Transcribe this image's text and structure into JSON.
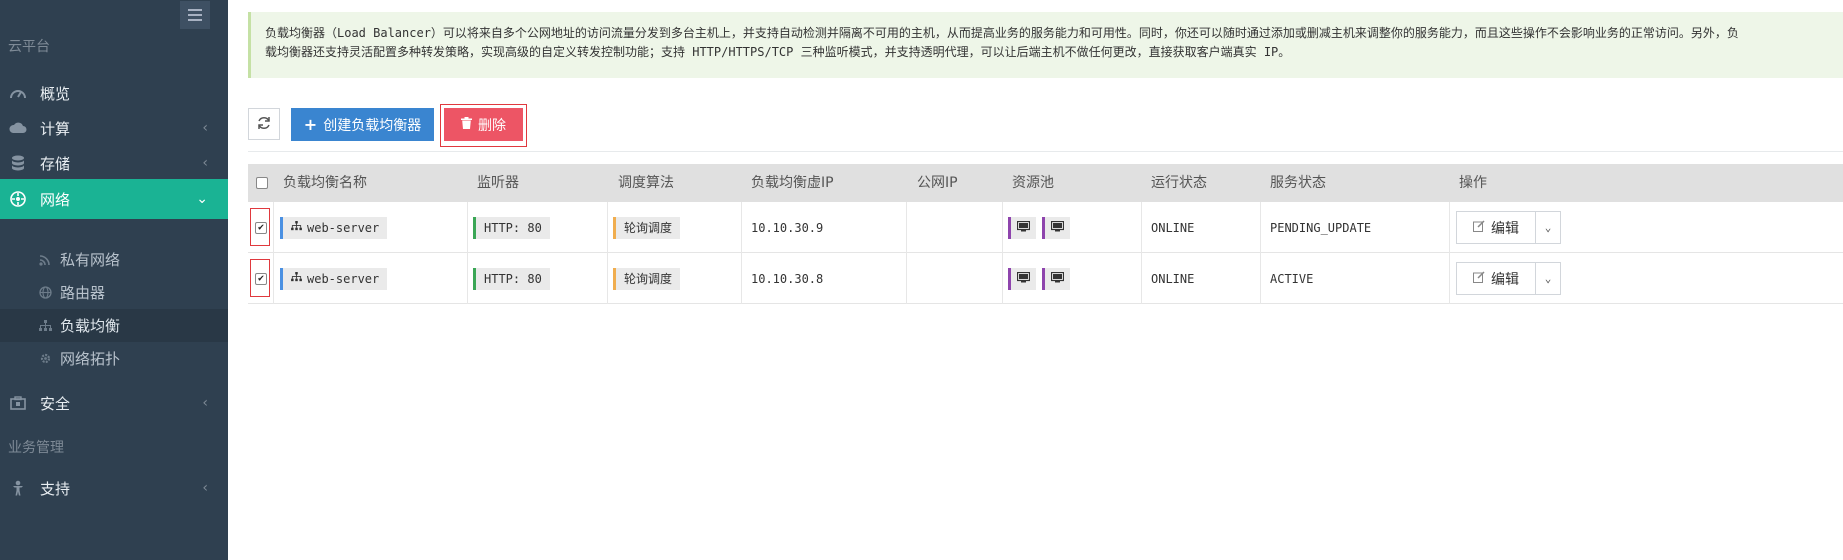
{
  "sidebar": {
    "section_cloud": "云平台",
    "section_business": "业务管理",
    "items": [
      {
        "label": "概览",
        "icon": "dashboard-icon"
      },
      {
        "label": "计算",
        "icon": "cloud-icon"
      },
      {
        "label": "存储",
        "icon": "database-icon"
      },
      {
        "label": "网络",
        "icon": "network-icon"
      },
      {
        "label": "安全",
        "icon": "suitcase-icon"
      },
      {
        "label": "支持",
        "icon": "support-icon"
      }
    ],
    "sub_items": [
      {
        "label": "私有网络",
        "icon": "rss-icon"
      },
      {
        "label": "路由器",
        "icon": "globe-icon"
      },
      {
        "label": "负载均衡",
        "icon": "sitemap-icon"
      },
      {
        "label": "网络拓扑",
        "icon": "gear-icon"
      }
    ]
  },
  "info": {
    "line1": "负载均衡器（Load Balancer）可以将来自多个公网地址的访问流量分发到多台主机上，并支持自动检测并隔离不可用的主机，从而提高业务的服务能力和可用性。同时，你还可以随时通过添加或删减主机来调整你的服务能力，而且这些操作不会影响业务的正常访问。另外，负",
    "line2": "载均衡器还支持灵活配置多种转发策略，实现高级的自定义转发控制功能；支持 HTTP/HTTPS/TCP 三种监听模式，并支持透明代理，可以让后端主机不做任何更改，直接获取客户端真实 IP。"
  },
  "toolbar": {
    "create_label": "创建负载均衡器",
    "delete_label": "删除"
  },
  "table": {
    "headers": [
      "负载均衡名称",
      "监听器",
      "调度算法",
      "负载均衡虚IP",
      "公网IP",
      "资源池",
      "运行状态",
      "服务状态",
      "操作"
    ],
    "rows": [
      {
        "checked": true,
        "name": "web-server",
        "listener": "HTTP: 80",
        "algorithm": "轮询调度",
        "vip": "10.10.30.9",
        "public_ip": "",
        "run_status": "ONLINE",
        "service_status": "PENDING_UPDATE",
        "action": "编辑"
      },
      {
        "checked": true,
        "name": "web-server",
        "listener": "HTTP: 80",
        "algorithm": "轮询调度",
        "vip": "10.10.30.8",
        "public_ip": "",
        "run_status": "ONLINE",
        "service_status": "ACTIVE",
        "action": "编辑"
      }
    ]
  },
  "colors": {
    "sidebar_bg": "#2f4050",
    "active_bg": "#1ab394",
    "create_button": "#3a85d0",
    "delete_button": "#ed5565",
    "info_bg": "#eef6e8"
  }
}
